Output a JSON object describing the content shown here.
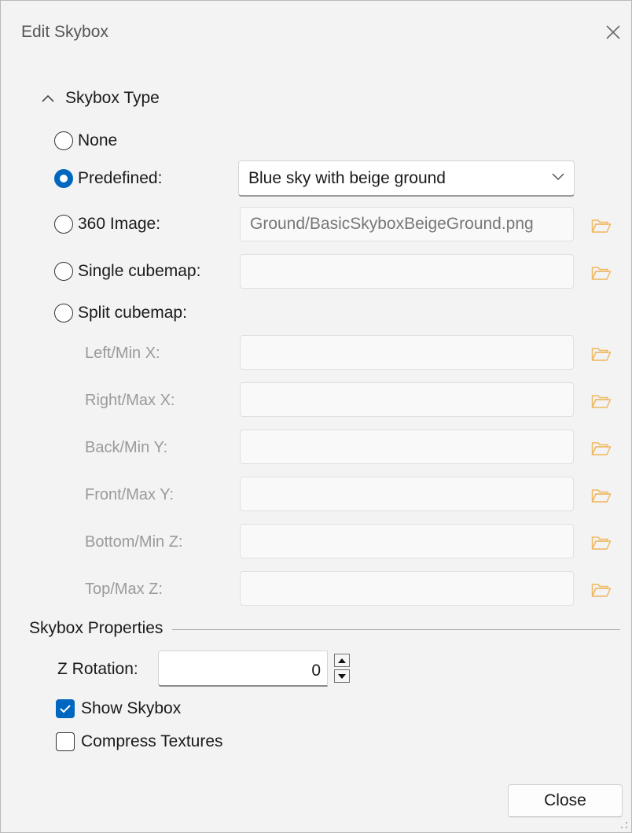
{
  "window": {
    "title": "Edit Skybox"
  },
  "skybox_type": {
    "header": "Skybox Type",
    "options": [
      {
        "label": "None",
        "checked": false
      },
      {
        "label": "Predefined:",
        "checked": true
      },
      {
        "label": "360 Image:",
        "checked": false
      },
      {
        "label": "Single cubemap:",
        "checked": false
      },
      {
        "label": "Split cubemap:",
        "checked": false
      }
    ],
    "predefined_value": "Blue sky with beige ground",
    "image_path": "Ground/BasicSkyboxBeigeGround.png",
    "single_cubemap_path": "",
    "split_faces": [
      {
        "label": "Left/Min X:",
        "value": ""
      },
      {
        "label": "Right/Max X:",
        "value": ""
      },
      {
        "label": "Back/Min Y:",
        "value": ""
      },
      {
        "label": "Front/Max Y:",
        "value": ""
      },
      {
        "label": "Bottom/Min Z:",
        "value": ""
      },
      {
        "label": "Top/Max Z:",
        "value": ""
      }
    ]
  },
  "properties": {
    "header": "Skybox Properties",
    "z_rotation_label": "Z Rotation:",
    "z_rotation_value": "0",
    "show_skybox_label": "Show Skybox",
    "show_skybox_checked": true,
    "compress_textures_label": "Compress Textures",
    "compress_textures_checked": false
  },
  "footer": {
    "close_label": "Close"
  },
  "colors": {
    "accent": "#0067c0",
    "folder": "#f0b860",
    "background": "#f3f3f3"
  },
  "icons": [
    "close-icon",
    "chevron-up-icon",
    "chevron-down-icon",
    "folder-icon",
    "spin-up-icon",
    "spin-down-icon",
    "checkmark-icon",
    "resize-grip-icon"
  ]
}
